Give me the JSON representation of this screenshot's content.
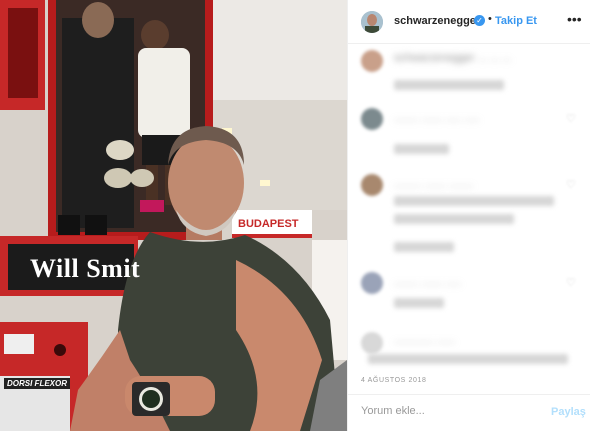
{
  "photo": {
    "wall_text": "Will Smit",
    "poster_text": "BUDAPEST",
    "device_title": "DORSI FLEXOR"
  },
  "header": {
    "username": "schwarzenegger",
    "verified_icon": "verified-badge-icon",
    "separator": "•",
    "follow_label": "Takip Et",
    "more_icon": "more-options-icon",
    "more_glyph": "•••"
  },
  "comments": [
    {
      "text": "schwarzenegger ... ... ...",
      "avatar_color": "#c9a08a"
    },
    {
      "text": "........ ....... ..... .....",
      "avatar_color": "#7c8a8e"
    },
    {
      "text": "......... ....... ........",
      "avatar_color": "#a8886e"
    },
    {
      "text": "........ ....... .....",
      "avatar_color": "#9aa3b8"
    },
    {
      "text": "............. ......",
      "avatar_color": "#d8d8d8"
    }
  ],
  "date": "4 AĞUSTOS 2018",
  "footer": {
    "comment_placeholder": "Yorum ekle...",
    "post_label": "Paylaş"
  },
  "colors": {
    "accent": "#3897f0",
    "post_disabled": "#b2dffc",
    "border": "#efefef"
  }
}
